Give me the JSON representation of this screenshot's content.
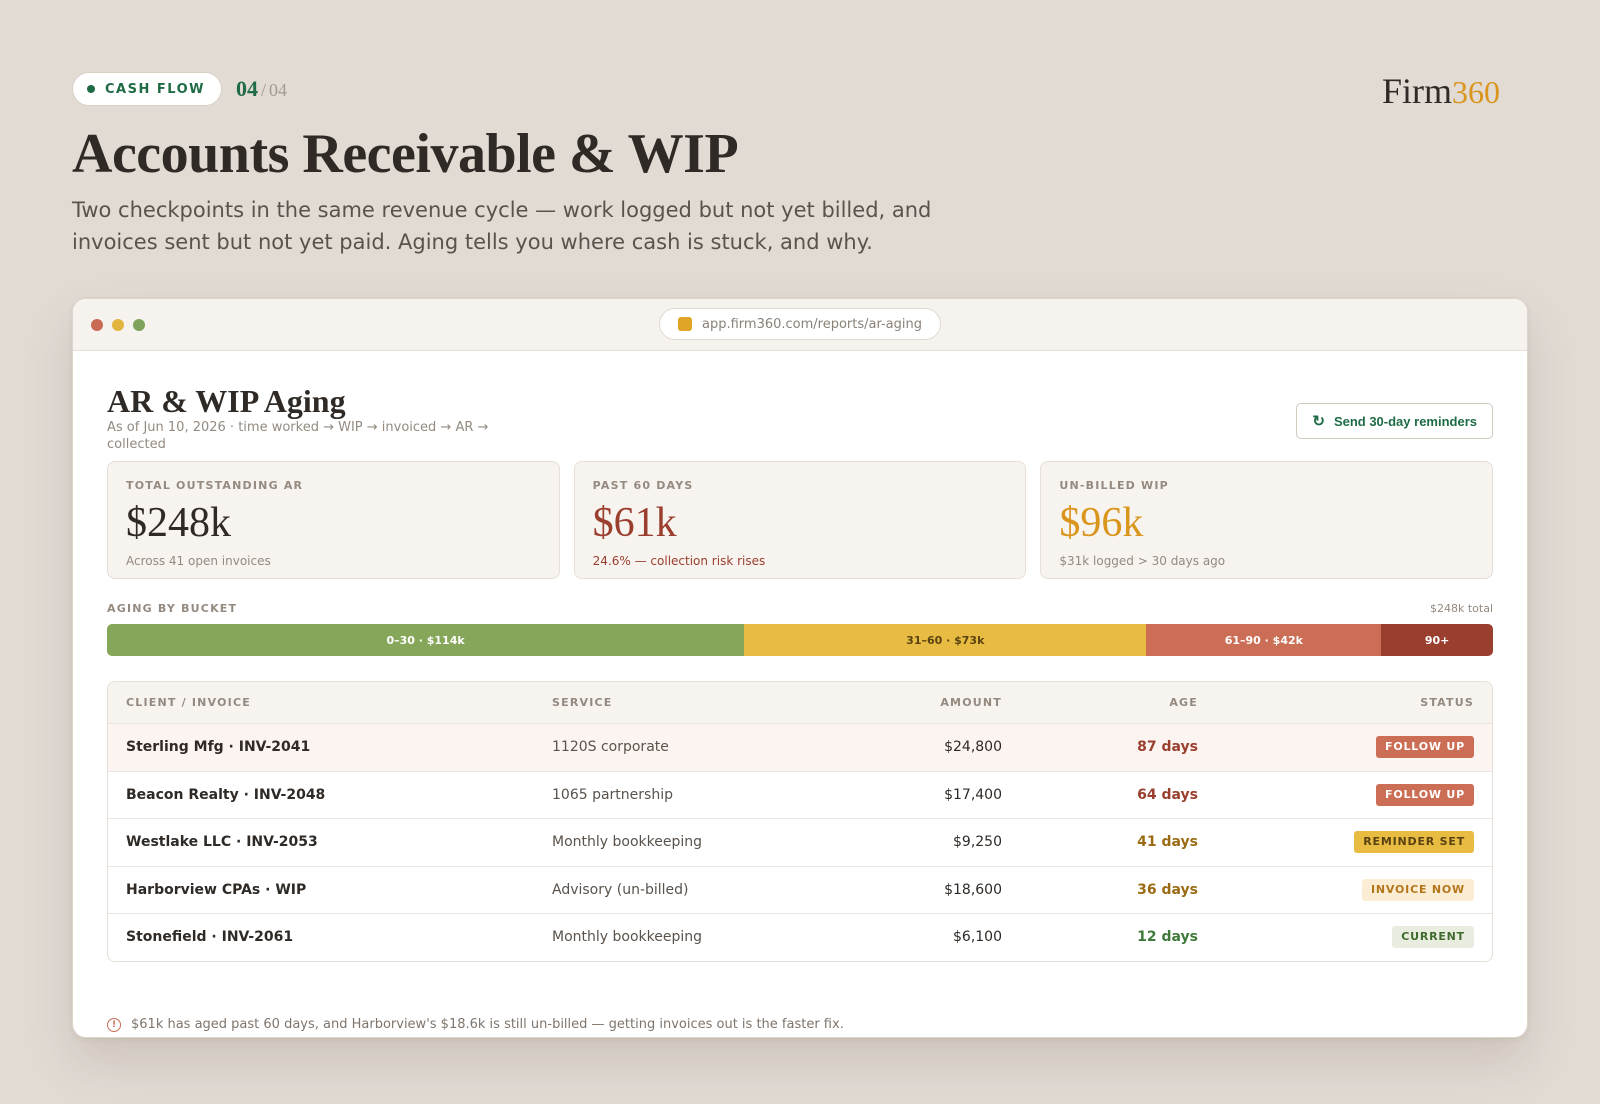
{
  "header": {
    "section_pill": "CASH FLOW",
    "page_current": "04",
    "page_sep": "/",
    "page_total": "04",
    "brand_main": "Firm",
    "brand_accent": "360",
    "title": "Accounts Receivable & WIP",
    "lede": "Two checkpoints in the same revenue cycle — work logged but not yet billed, and invoices sent but not yet paid. Aging tells you where cash is stuck, and why."
  },
  "browser": {
    "url": "app.firm360.com/reports/ar-aging"
  },
  "report": {
    "title": "AR & WIP Aging",
    "subtitle": "As of Jun 10, 2026 · time worked → WIP → invoiced → AR → collected",
    "action_button": "Send 30-day reminders"
  },
  "kpis": [
    {
      "label": "TOTAL OUTSTANDING AR",
      "value": "$248k",
      "note": "Across 41 open invoices",
      "tone": "dark"
    },
    {
      "label": "PAST 60 DAYS",
      "value": "$61k",
      "note": "24.6% — collection risk rises",
      "tone": "red"
    },
    {
      "label": "UN-BILLED WIP",
      "value": "$96k",
      "note": "$31k logged > 30 days ago",
      "tone": "gold"
    }
  ],
  "aging": {
    "label": "AGING BY BUCKET",
    "total": "$248k total",
    "buckets": [
      {
        "label": "0–30 · $114k",
        "amount_k": 114,
        "color": "#86a65a",
        "text_color": "#ffffff"
      },
      {
        "label": "31–60 · $73k",
        "amount_k": 72,
        "color": "#e8bb42",
        "text_color": "#5a4310"
      },
      {
        "label": "61–90 · $42k",
        "amount_k": 42,
        "color": "#cc6e55",
        "text_color": "#ffffff"
      },
      {
        "label": "90+",
        "amount_k": 20,
        "color": "#9a3e2e",
        "text_color": "#ffffff"
      }
    ]
  },
  "table": {
    "columns": [
      "CLIENT / INVOICE",
      "SERVICE",
      "AMOUNT",
      "AGE",
      "STATUS"
    ],
    "rows": [
      {
        "client": "Sterling Mfg · INV-2041",
        "service": "1120S corporate",
        "amount": "$24,800",
        "age": "87 days",
        "age_color": "#9a3e2e",
        "status": "FOLLOW UP",
        "status_bg": "#cc6e55",
        "status_fg": "#ffffff",
        "highlight": true
      },
      {
        "client": "Beacon Realty · INV-2048",
        "service": "1065 partnership",
        "amount": "$17,400",
        "age": "64 days",
        "age_color": "#9a3e2e",
        "status": "FOLLOW UP",
        "status_bg": "#cc6e55",
        "status_fg": "#ffffff",
        "highlight": false
      },
      {
        "client": "Westlake LLC · INV-2053",
        "service": "Monthly bookkeeping",
        "amount": "$9,250",
        "age": "41 days",
        "age_color": "#9a6b12",
        "status": "REMINDER SET",
        "status_bg": "#e8bb42",
        "status_fg": "#5a4310",
        "highlight": false
      },
      {
        "client": "Harborview CPAs · WIP",
        "service": "Advisory (un-billed)",
        "amount": "$18,600",
        "age": "36 days",
        "age_color": "#9a6b12",
        "status": "INVOICE NOW",
        "status_bg": "#fbecd4",
        "status_fg": "#b5761a",
        "highlight": false
      },
      {
        "client": "Stonefield · INV-2061",
        "service": "Monthly bookkeeping",
        "amount": "$6,100",
        "age": "12 days",
        "age_color": "#3f7a3a",
        "status": "CURRENT",
        "status_bg": "#e8eddf",
        "status_fg": "#3f6b2e",
        "highlight": false
      }
    ]
  },
  "footnote": "$61k has aged past 60 days, and Harborview's $18.6k is still un-billed — getting invoices out is the faster fix."
}
